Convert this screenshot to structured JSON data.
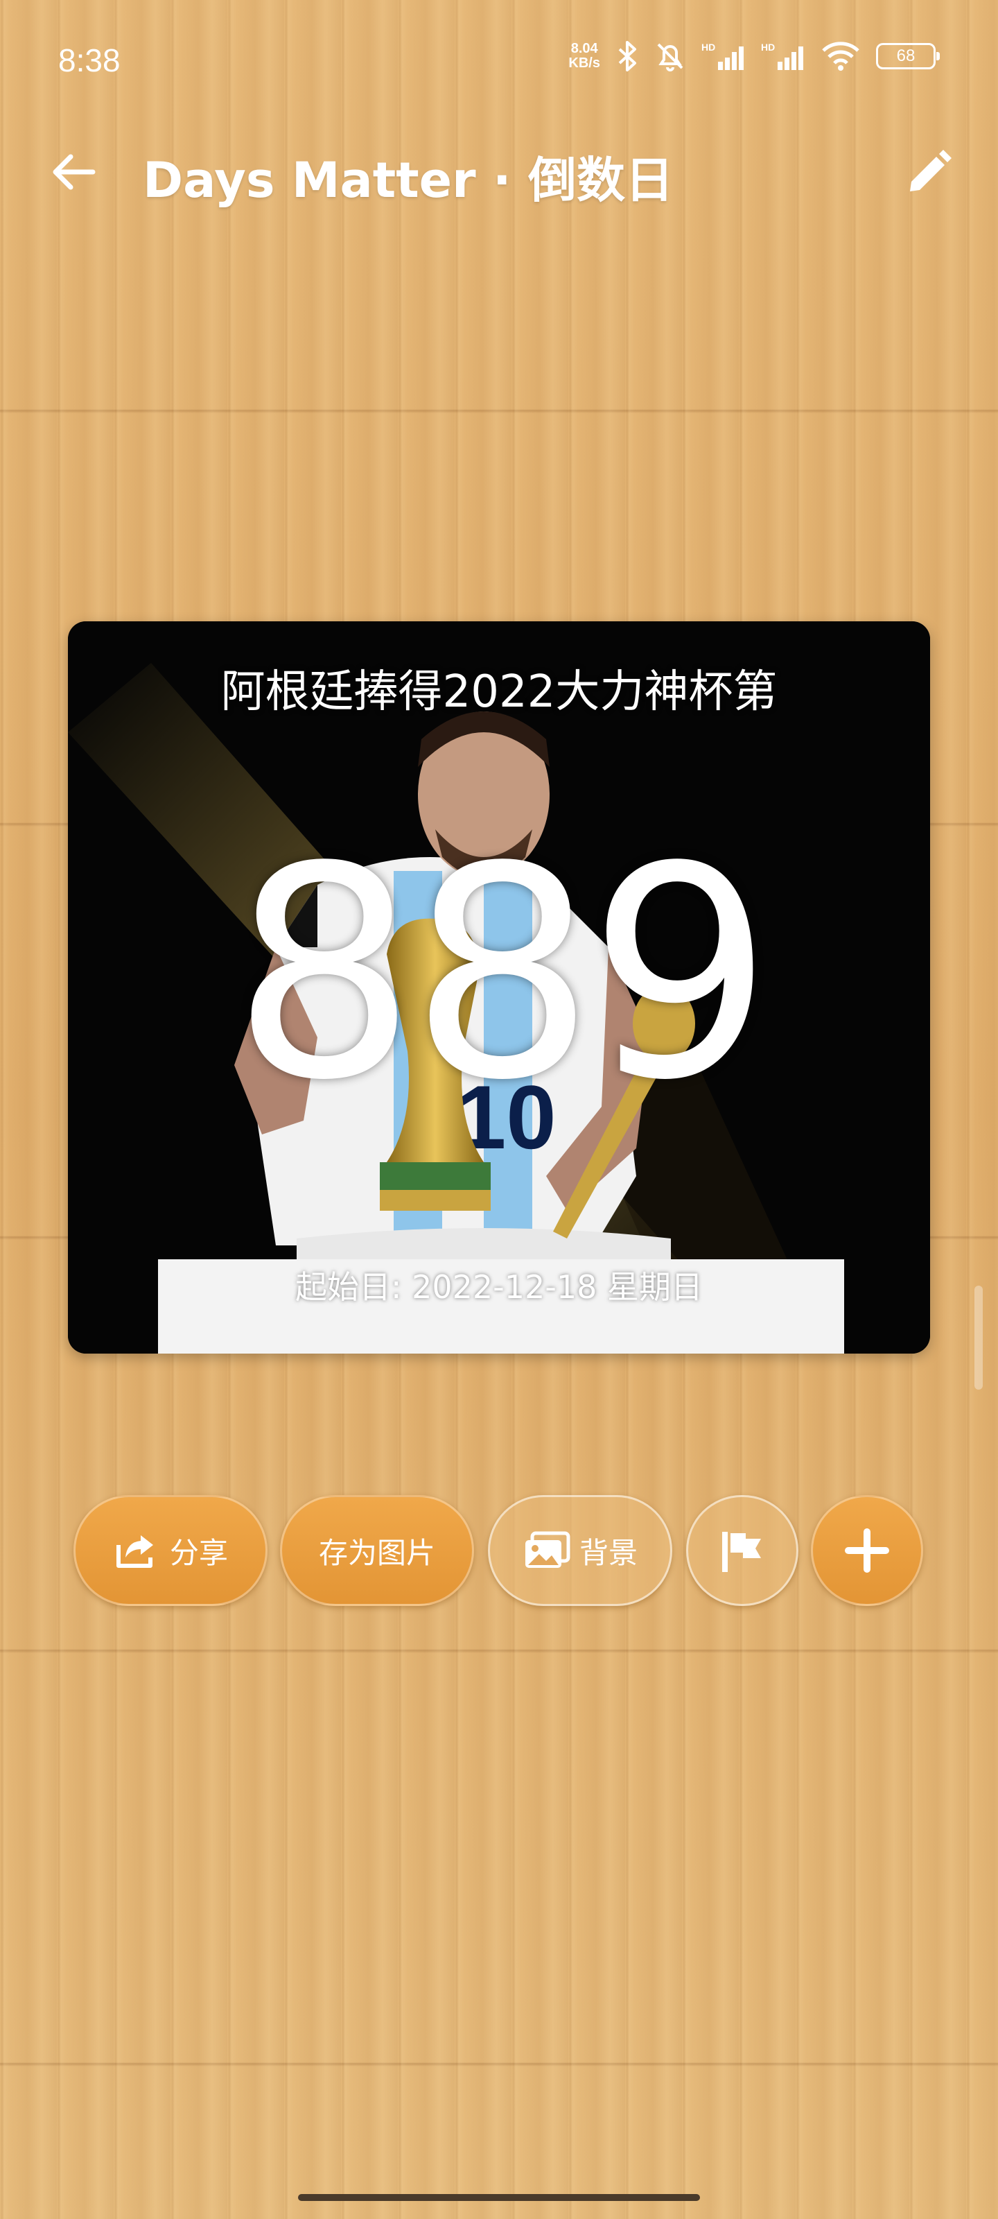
{
  "status_bar": {
    "time": "8:38",
    "net_speed_value": "8.04",
    "net_speed_unit": "KB/s",
    "battery": "68",
    "icons": [
      "bluetooth-icon",
      "mute-bell-icon",
      "hd-signal-icon",
      "hd-signal-icon",
      "wifi-icon",
      "battery-icon"
    ]
  },
  "app_bar": {
    "title": "Days Matter · 倒数日",
    "back_icon": "arrow-left-icon",
    "edit_icon": "pencil-icon"
  },
  "event": {
    "title": "阿根廷捧得2022大力神杯第",
    "days": "889",
    "start_date": "起始日: 2022-12-18 星期日"
  },
  "actions": {
    "share_label": "分享",
    "save_image_label": "存为图片",
    "background_label": "背景",
    "flag_icon": "flag-icon",
    "add_icon": "plus-icon"
  },
  "colors": {
    "accent": "#E89A3A",
    "wood": "#E2B272",
    "text_on_wood": "#FFFFFF"
  }
}
